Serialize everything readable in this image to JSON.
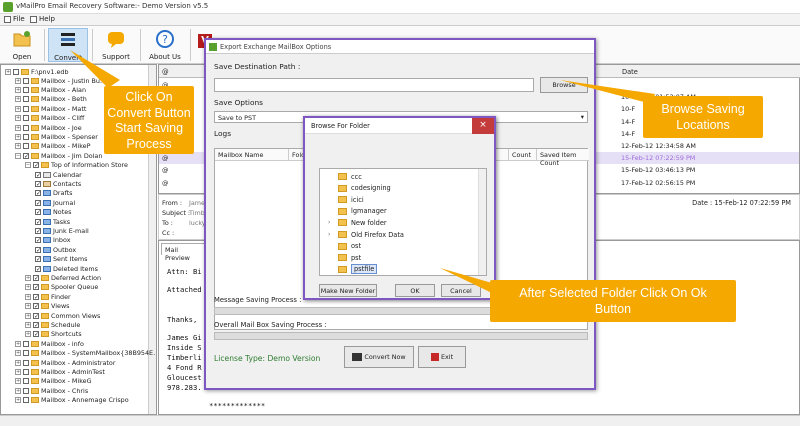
{
  "window": {
    "title": "vMailPro Email Recovery Software:- Demo Version v5.5"
  },
  "menu": {
    "file": "File",
    "help": "Help"
  },
  "toolbar": {
    "open": "Open",
    "convert": "Convert",
    "support": "Support",
    "about": "About Us"
  },
  "tree": {
    "root": "F:\\pnv1.edb",
    "items": [
      "Mailbox - Justin Bu…",
      "Mailbox - Alan",
      "Mailbox - Beth",
      "Mailbox - Matt",
      "Mailbox - Cliff",
      "Mailbox - Joe",
      "Mailbox - Spenser",
      "Mailbox - MikeP",
      "Mailbox - Jim Dolan",
      "Top of Information Store",
      "Calendar",
      "Contacts",
      "Drafts",
      "Journal",
      "Notes",
      "Tasks",
      "Junk E-mail",
      "Inbox",
      "Outbox",
      "Sent Items",
      "Deleted Items",
      "Deferred Action",
      "Spooler Queue",
      "Finder",
      "Views",
      "Common Views",
      "Schedule",
      "Shortcuts",
      "Mailbox - info",
      "Mailbox - SystemMailbox{38B954E…",
      "Mailbox - Administrator",
      "Mailbox - AdminTest",
      "Mailbox - MikeG",
      "Mailbox - Chris",
      "Mailbox - Annemage Crispo"
    ]
  },
  "grid": {
    "date_header": "Date",
    "dates": [
      "10-Feb-12 01:52:07 AM",
      "10-F",
      "14-F",
      "14-F",
      "12-Feb-12 12:34:58 AM",
      "15-Feb-12 07:22:59 PM",
      "15-Feb-12 03:46:13 PM",
      "17-Feb-12 02:56:15 PM"
    ],
    "at": "@"
  },
  "props": {
    "from": "From :",
    "from_val": "James",
    "subject": "Subject :",
    "subject_val": "Timbe",
    "to": "To :",
    "to_val": "luckyO",
    "cc": "Cc :",
    "date": "Date :  15-Feb-12 07:22:59 PM"
  },
  "preview": {
    "tab": "Mail Preview",
    "lines": [
      "Attn: Bi",
      "Attached",
      "Thanks,",
      "James Gi",
      "Inside S",
      "Timberli",
      "4 Fond R",
      "Gloucest",
      "978.283.",
      "*************"
    ]
  },
  "export_dialog": {
    "title": "Export Exchange MailBox Options",
    "save_dest": "Save Destination Path :",
    "browse": "Browse",
    "save_options": "Save Options",
    "save_to": "Save to PST",
    "logs": "Logs",
    "col_mailbox": "Mailbox Name",
    "col_folder": "Folde",
    "col_count": "Count",
    "col_saved": "Saved Item Count",
    "msg_progress": "Message Saving Process :",
    "overall_progress": "Overall Mail Box Saving Process :",
    "license": "License Type: Demo Version",
    "convert_now": "Convert Now",
    "exit": "Exit"
  },
  "browse_dialog": {
    "title": "Browse For Folder",
    "folders": [
      "ccc",
      "codesigning",
      "icici",
      "lgmanager",
      "New folder",
      "Old Firefox Data",
      "ost",
      "pst",
      "pstfile"
    ],
    "make_new": "Make New Folder",
    "ok": "OK",
    "cancel": "Cancel"
  },
  "callouts": {
    "convert": "Click On Convert Button Start Saving Process",
    "browse": "Browse Saving Locations",
    "ok": "After Selected Folder Click On Ok Button"
  },
  "colors": {
    "callout": "#f5a800",
    "dialog_border": "#7e57c2",
    "license": "#2e7d32"
  }
}
